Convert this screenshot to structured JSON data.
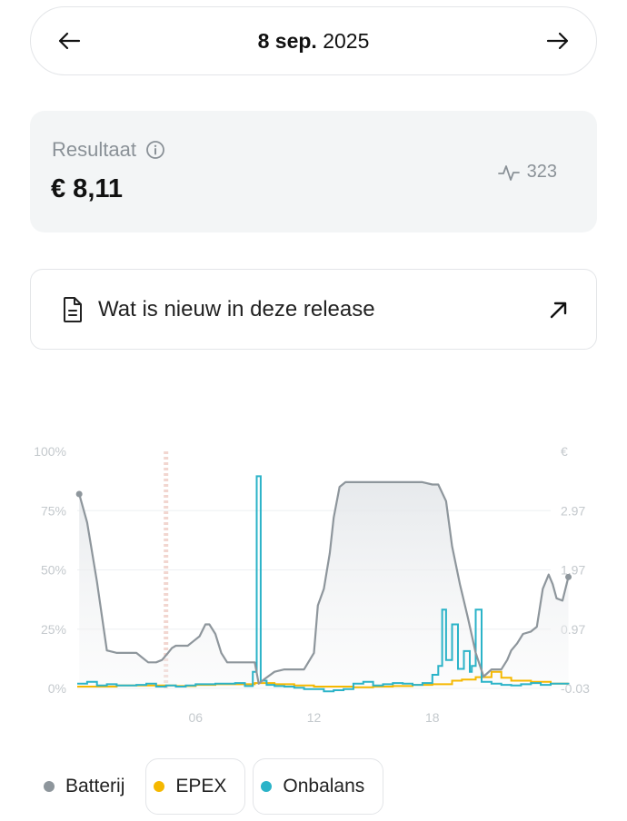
{
  "date_nav": {
    "day": "8 sep.",
    "year": "2025"
  },
  "result": {
    "title": "Resultaat",
    "value": "€ 8,11",
    "cycles": "323"
  },
  "release": {
    "label": "Wat is nieuw in deze release"
  },
  "colors": {
    "batterij": "#8e969c",
    "epex": "#f5b800",
    "onbalans": "#2bb3c8",
    "muted": "#c4c9cd"
  },
  "chart_data": {
    "type": "line",
    "left_axis": {
      "ticks": [
        "100%",
        "75%",
        "50%",
        "25%",
        "0%"
      ],
      "ylim": [
        0,
        100
      ]
    },
    "right_axis": {
      "ticks": [
        "€",
        "2.97",
        "1.97",
        "0.97",
        "-0.03"
      ],
      "ylim": [
        -0.03,
        3.97
      ]
    },
    "x_ticks": [
      "06",
      "12",
      "18"
    ],
    "xlim": [
      0,
      24
    ],
    "now_marker_hour": 4.5,
    "series": [
      {
        "name": "Batterij",
        "axis": "left",
        "points": [
          [
            0.1,
            82
          ],
          [
            0.5,
            70
          ],
          [
            1,
            45
          ],
          [
            1.5,
            16
          ],
          [
            2,
            15
          ],
          [
            2.5,
            15
          ],
          [
            3,
            15
          ],
          [
            3.3,
            13
          ],
          [
            3.6,
            11
          ],
          [
            4,
            11
          ],
          [
            4.3,
            12
          ],
          [
            4.6,
            15
          ],
          [
            4.8,
            17
          ],
          [
            5,
            18
          ],
          [
            5.2,
            18
          ],
          [
            5.6,
            18
          ],
          [
            5.9,
            20
          ],
          [
            6.2,
            22
          ],
          [
            6.5,
            27
          ],
          [
            6.7,
            27
          ],
          [
            7,
            23
          ],
          [
            7.3,
            15
          ],
          [
            7.6,
            11
          ],
          [
            8,
            11
          ],
          [
            8.5,
            11
          ],
          [
            9,
            11
          ],
          [
            9.2,
            2
          ],
          [
            9.5,
            4
          ],
          [
            10,
            7
          ],
          [
            10.5,
            8
          ],
          [
            11,
            8
          ],
          [
            11.5,
            8
          ],
          [
            12,
            15
          ],
          [
            12.2,
            35
          ],
          [
            12.5,
            42
          ],
          [
            12.8,
            57
          ],
          [
            13,
            72
          ],
          [
            13.3,
            85
          ],
          [
            13.6,
            87
          ],
          [
            14,
            87
          ],
          [
            15,
            87
          ],
          [
            16,
            87
          ],
          [
            17,
            87
          ],
          [
            17.5,
            87
          ],
          [
            18,
            86
          ],
          [
            18.3,
            86
          ],
          [
            18.7,
            79
          ],
          [
            19,
            60
          ],
          [
            19.4,
            44
          ],
          [
            19.8,
            30
          ],
          [
            20.2,
            15
          ],
          [
            20.6,
            5
          ],
          [
            21,
            8
          ],
          [
            21.5,
            8
          ],
          [
            21.8,
            12
          ],
          [
            22,
            16
          ],
          [
            22.3,
            19
          ],
          [
            22.6,
            23
          ],
          [
            23,
            24
          ],
          [
            23.3,
            26
          ],
          [
            23.6,
            42
          ],
          [
            23.9,
            48
          ],
          [
            24.1,
            44
          ],
          [
            24.3,
            38
          ],
          [
            24.6,
            37
          ],
          [
            24.9,
            47
          ]
        ]
      },
      {
        "name": "EPEX",
        "axis": "right",
        "points": [
          [
            0,
            0.0
          ],
          [
            2,
            0.02
          ],
          [
            4,
            0.02
          ],
          [
            5,
            0.01
          ],
          [
            6,
            0.03
          ],
          [
            7,
            0.04
          ],
          [
            8,
            0.04
          ],
          [
            9,
            0.06
          ],
          [
            10,
            0.04
          ],
          [
            11,
            0.02
          ],
          [
            12,
            0.0
          ],
          [
            14,
            -0.01
          ],
          [
            15,
            0.0
          ],
          [
            16,
            0.01
          ],
          [
            17,
            0.03
          ],
          [
            18,
            0.04
          ],
          [
            19,
            0.1
          ],
          [
            19.5,
            0.12
          ],
          [
            20.2,
            0.16
          ],
          [
            21,
            0.25
          ],
          [
            21.5,
            0.15
          ],
          [
            22,
            0.1
          ],
          [
            23,
            0.08
          ],
          [
            24,
            0.05
          ],
          [
            24.9,
            0.05
          ]
        ]
      },
      {
        "name": "Onbalans",
        "axis": "right",
        "points": [
          [
            0,
            0.05
          ],
          [
            0.5,
            0.08
          ],
          [
            1,
            0.02
          ],
          [
            1.5,
            0.04
          ],
          [
            2,
            0.02
          ],
          [
            3,
            0.03
          ],
          [
            3.5,
            0.05
          ],
          [
            4,
            0.0
          ],
          [
            4.5,
            0.02
          ],
          [
            5,
            0.0
          ],
          [
            5.5,
            0.02
          ],
          [
            6,
            0.04
          ],
          [
            7,
            0.05
          ],
          [
            8,
            0.06
          ],
          [
            8.5,
            0.01
          ],
          [
            8.9,
            0.25
          ],
          [
            9.1,
            3.55
          ],
          [
            9.3,
            0.1
          ],
          [
            9.6,
            0.03
          ],
          [
            10,
            0.01
          ],
          [
            10.5,
            0.0
          ],
          [
            11,
            -0.02
          ],
          [
            11.5,
            -0.04
          ],
          [
            12,
            -0.04
          ],
          [
            12.5,
            -0.08
          ],
          [
            13,
            -0.06
          ],
          [
            13.5,
            -0.04
          ],
          [
            14,
            0.05
          ],
          [
            14.5,
            0.08
          ],
          [
            15,
            0.02
          ],
          [
            15.5,
            0.04
          ],
          [
            16,
            0.06
          ],
          [
            16.5,
            0.05
          ],
          [
            17,
            0.03
          ],
          [
            17.5,
            0.06
          ],
          [
            18,
            0.2
          ],
          [
            18.3,
            0.35
          ],
          [
            18.5,
            1.3
          ],
          [
            18.7,
            0.45
          ],
          [
            19,
            1.05
          ],
          [
            19.3,
            0.3
          ],
          [
            19.6,
            0.6
          ],
          [
            19.9,
            0.25
          ],
          [
            20,
            0.35
          ],
          [
            20.2,
            1.3
          ],
          [
            20.5,
            0.08
          ],
          [
            21,
            0.05
          ],
          [
            21.5,
            0.03
          ],
          [
            22,
            0.02
          ],
          [
            22.5,
            0.04
          ],
          [
            23,
            0.06
          ],
          [
            23.5,
            0.03
          ],
          [
            24,
            0.05
          ],
          [
            24.9,
            0.04
          ]
        ]
      }
    ]
  },
  "legend": [
    {
      "label": "Batterij",
      "color": "#8e969c"
    },
    {
      "label": "EPEX",
      "color": "#f5b800"
    },
    {
      "label": "Onbalans",
      "color": "#2bb3c8"
    }
  ]
}
